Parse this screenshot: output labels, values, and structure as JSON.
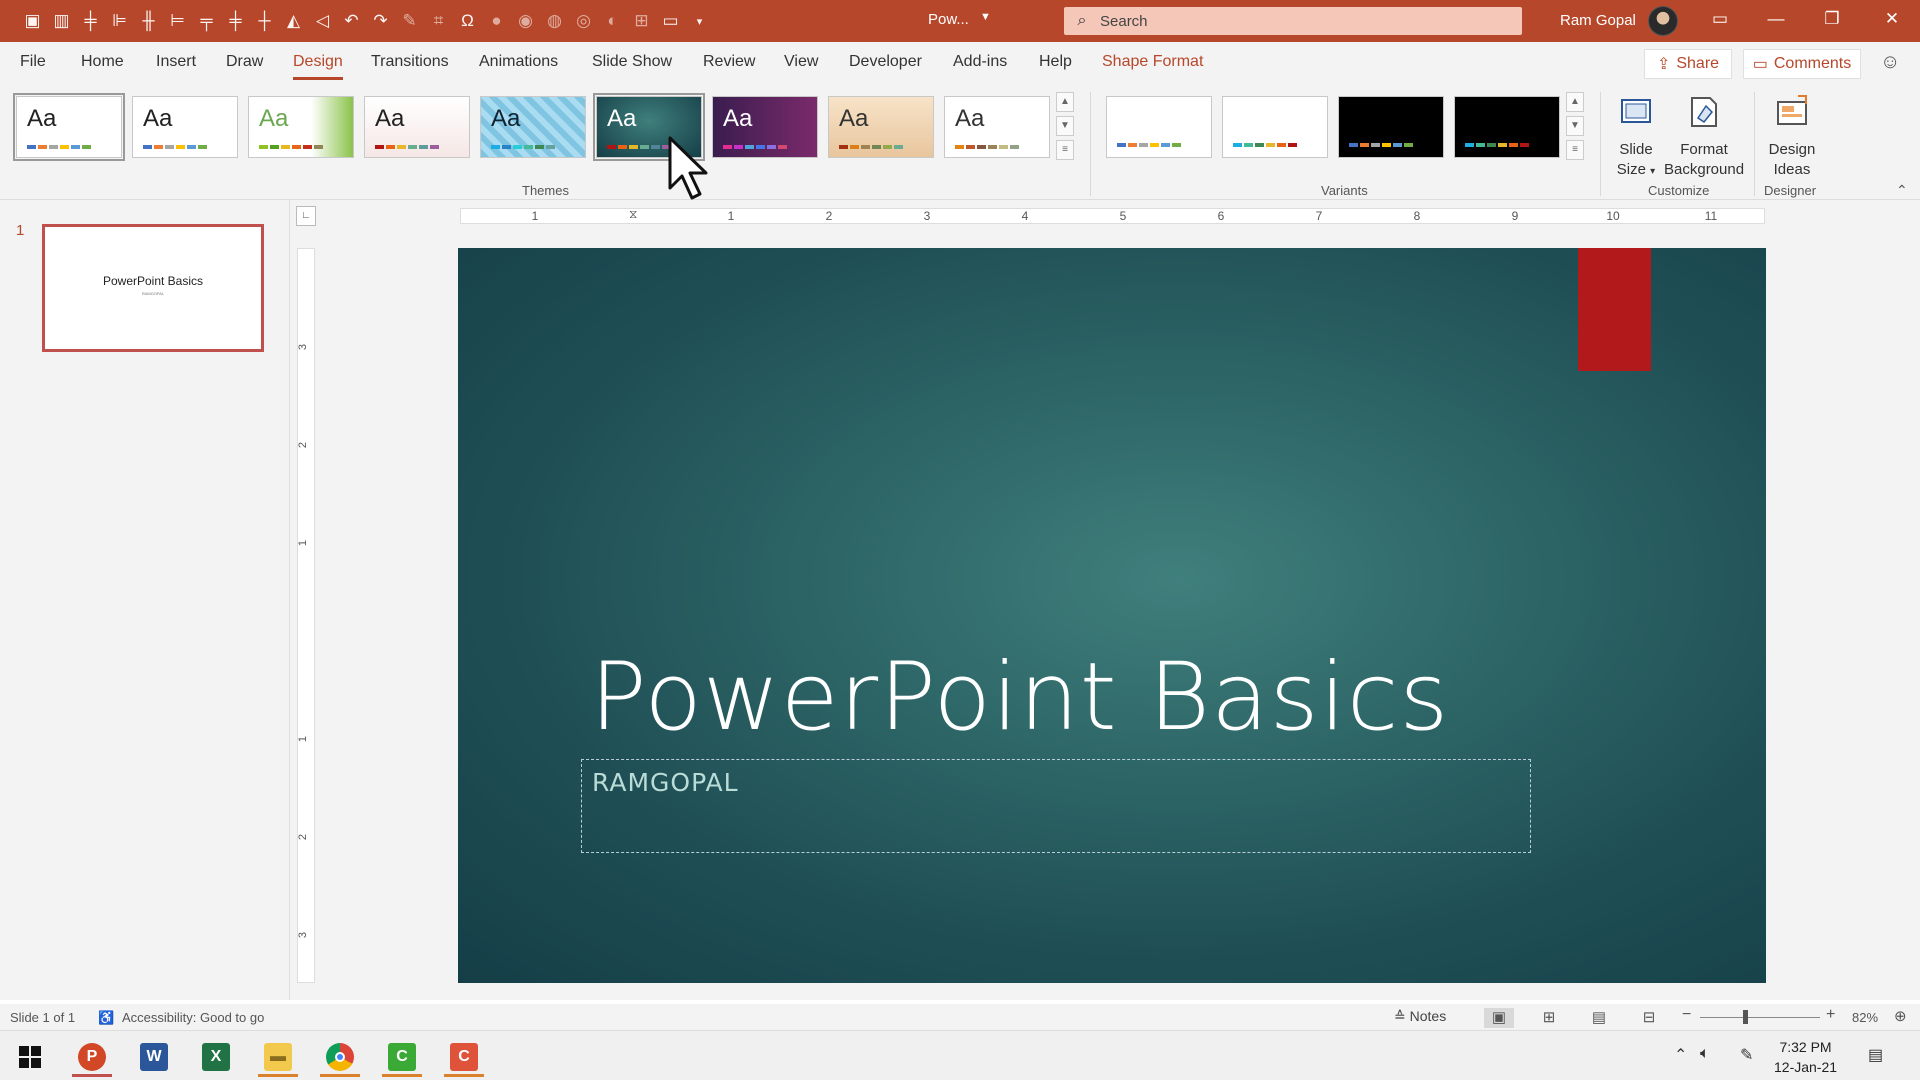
{
  "titlebar": {
    "doc_name": "Pow...",
    "search_placeholder": "Search",
    "user_name": "Ram Gopal"
  },
  "tabs": [
    "File",
    "Home",
    "Insert",
    "Draw",
    "Design",
    "Transitions",
    "Animations",
    "Slide Show",
    "Review",
    "View",
    "Developer",
    "Add-ins",
    "Help",
    "Shape Format"
  ],
  "active_tab": "Design",
  "share_label": "Share",
  "comments_label": "Comments",
  "ribbon": {
    "themes_label": "Themes",
    "variants_label": "Variants",
    "customize_label": "Customize",
    "designer_label": "Designer",
    "theme_aa": "Aa",
    "slide_size_line1": "Slide",
    "slide_size_line2": "Size",
    "format_background_line1": "Format",
    "format_background_line2": "Background",
    "design_ideas_line1": "Design",
    "design_ideas_line2": "Ideas"
  },
  "ruler": {
    "h_labels": [
      "1",
      "1",
      "2",
      "3",
      "4",
      "5",
      "6",
      "7",
      "8",
      "9",
      "10",
      "11"
    ],
    "v_labels": [
      "3",
      "2",
      "1",
      "1",
      "2",
      "3"
    ]
  },
  "slide_panel": {
    "slide_number": "1",
    "thumb_title": "PowerPoint Basics",
    "thumb_subtitle": "RAMGOPAL"
  },
  "slide": {
    "title": "PowerPoint Basics",
    "subtitle": "RAMGOPAL"
  },
  "status": {
    "slide_of": "Slide 1 of 1",
    "accessibility": "Accessibility: Good to go",
    "notes": "Notes",
    "zoom": "82%"
  },
  "taskbar": {
    "time": "7:32 PM",
    "date": "12-Jan-21"
  },
  "colors": {
    "accent": "#b7472a",
    "slide_bg": "#2d6566",
    "slide_red": "#b2191b"
  }
}
